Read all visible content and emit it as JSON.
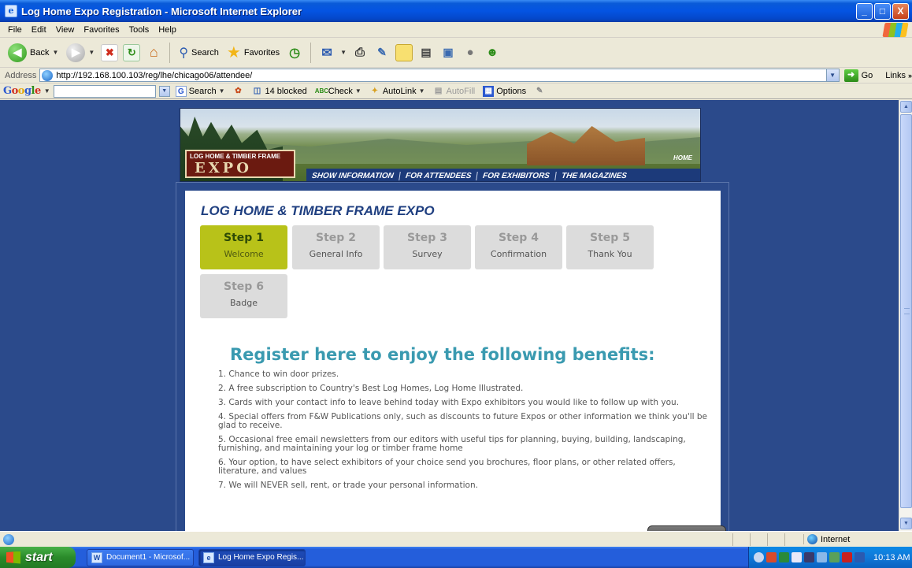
{
  "window": {
    "title": "Log Home Expo Registration - Microsoft Internet Explorer",
    "controls": [
      "_",
      "□",
      "X"
    ]
  },
  "menu": [
    "File",
    "Edit",
    "View",
    "Favorites",
    "Tools",
    "Help"
  ],
  "toolbar": {
    "back": "Back",
    "search": "Search",
    "favorites": "Favorites"
  },
  "address": {
    "label": "Address",
    "url": "http://192.168.100.103/reg/lhe/chicago06/attendee/",
    "go": "Go",
    "links": "Links"
  },
  "google_bar": {
    "logo": "Google",
    "search": "Search",
    "blocked": "14 blocked",
    "check": "Check",
    "autolink": "AutoLink",
    "autofill": "AutoFill",
    "options": "Options"
  },
  "banner": {
    "logo_top": "LOG HOME & TIMBER FRAME",
    "logo_bottom": "EXPO",
    "home": "HOME",
    "nav": [
      "SHOW INFORMATION",
      "FOR ATTENDEES",
      "FOR EXHIBITORS",
      "THE MAGAZINES"
    ]
  },
  "page": {
    "heading": "LOG HOME & TIMBER FRAME EXPO",
    "steps": [
      {
        "num": "Step 1",
        "label": "Welcome",
        "active": true
      },
      {
        "num": "Step 2",
        "label": "General Info",
        "active": false
      },
      {
        "num": "Step 3",
        "label": "Survey",
        "active": false
      },
      {
        "num": "Step 4",
        "label": "Confirmation",
        "active": false
      },
      {
        "num": "Step 5",
        "label": "Thank You",
        "active": false
      },
      {
        "num": "Step 6",
        "label": "Badge",
        "active": false
      }
    ],
    "benefits_title": "Register here to enjoy the following benefits:",
    "benefits": [
      "1. Chance to win door prizes.",
      "2. A free subscription to Country's Best Log Homes, Log Home Illustrated.",
      "3. Cards with your contact info to leave behind today with Expo exhibitors you would like to follow up with you.",
      "4. Special offers from F&W Publications only, such as discounts to future Expos or other information we think you'll be glad to receive.",
      "5. Occasional free email newsletters from our editors with useful tips for planning, buying, building, landscaping, furnishing, and maintaining your log or timber frame home",
      "6. Your option, to have select exhibitors of your choice send you brochures, floor plans, or other related offers, literature, and values",
      "7. We will NEVER sell, rent, or trade your personal information."
    ]
  },
  "status": {
    "zone": "Internet"
  },
  "taskbar": {
    "start": "start",
    "tasks": [
      "Document1 - Microsof...",
      "Log Home Expo Regis..."
    ],
    "clock": "10:13 AM"
  },
  "colors": {
    "page_bg": "#2b4a8b",
    "step_active": "#b8c219",
    "heading": "#1f3f80",
    "benefits_title": "#3a9ab0"
  }
}
